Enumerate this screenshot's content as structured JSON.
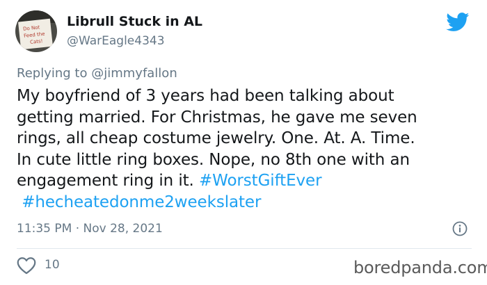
{
  "author": {
    "display_name": "Librull Stuck in AL",
    "handle": "@WarEagle4343",
    "avatar_sign_text": [
      "Do Not",
      "Feed the",
      "Cats!"
    ]
  },
  "reply": {
    "prefix": "Replying to",
    "mention": "@jimmyfallon"
  },
  "tweet": {
    "lines": [
      "My boyfriend of 3 years had been talking about",
      "getting married. For Christmas, he gave me seven",
      "rings, all cheap costume jewelry. One. At. A. Time.",
      "In cute little ring boxes. Nope, no 8th one with an"
    ],
    "line5_text": "engagement ring in it. ",
    "hashtag1": "#WorstGiftEver",
    "hashtag2": "#hecheatedonme2weekslater"
  },
  "meta": {
    "timestamp": "11:35 PM · Nov 28, 2021"
  },
  "engagement": {
    "likes": "10"
  },
  "watermark": "boredpanda.com",
  "icons": {
    "brand": "twitter-bird-icon",
    "info": "info-icon",
    "like": "heart-icon"
  },
  "colors": {
    "accent": "#1da1f2",
    "text": "#14171a",
    "muted": "#657786",
    "divider": "#e1e8ed"
  }
}
